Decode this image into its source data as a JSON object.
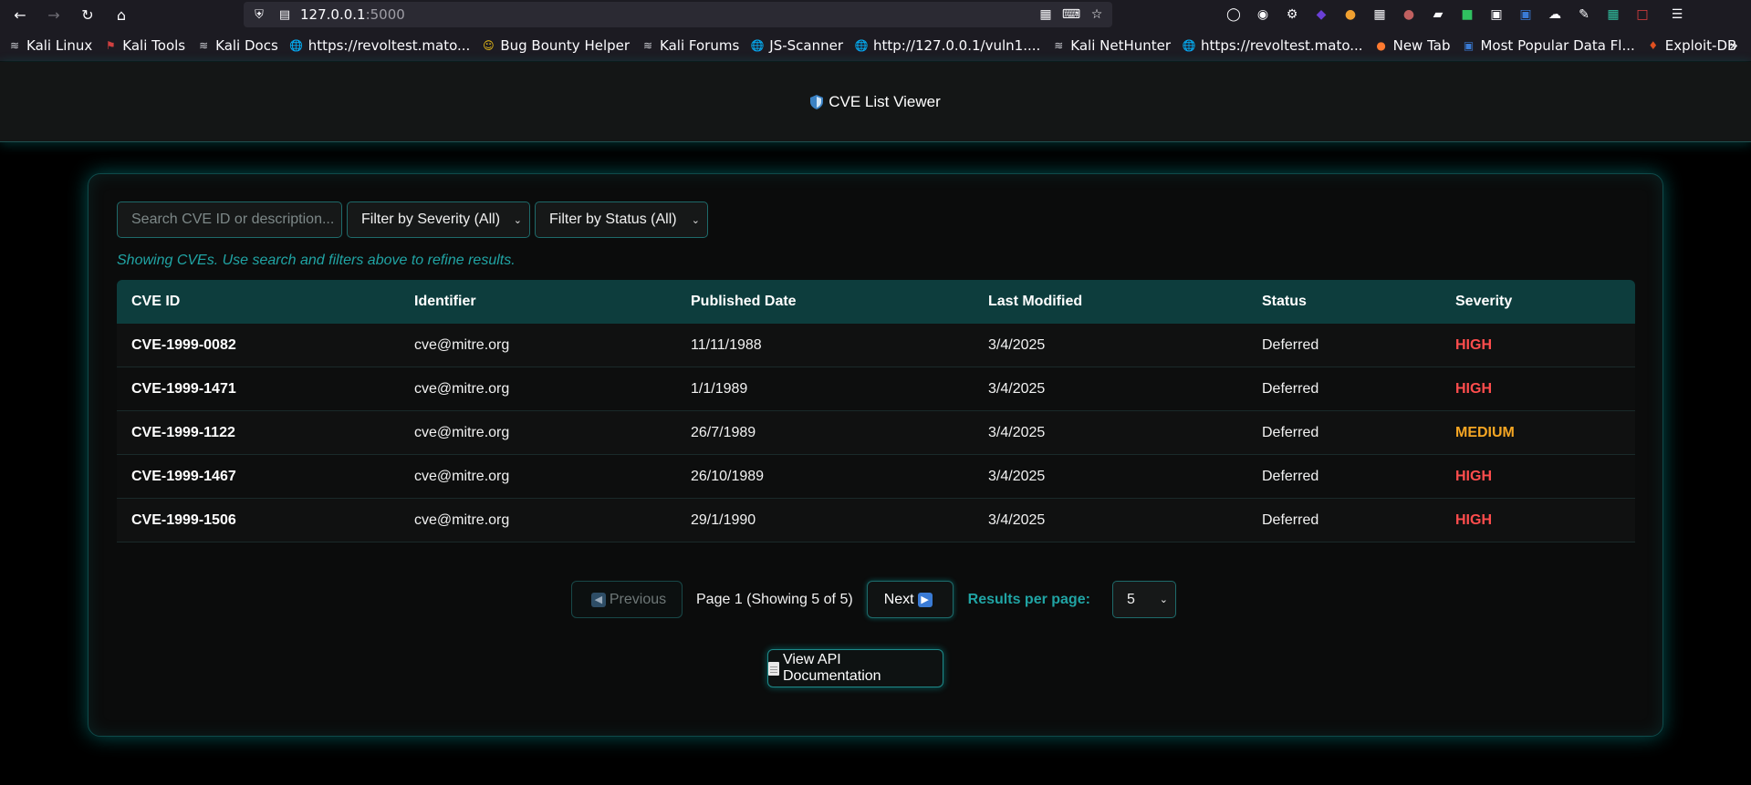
{
  "browser": {
    "url_host": "127.0.0.1",
    "url_port": ":5000",
    "bookmarks": [
      {
        "label": "Kali Linux",
        "icon": "kali-dragon-icon"
      },
      {
        "label": "Kali Tools",
        "icon": "kali-tools-icon"
      },
      {
        "label": "Kali Docs",
        "icon": "kali-dragon-icon"
      },
      {
        "label": "https://revoltest.mato...",
        "icon": "globe-icon"
      },
      {
        "label": "Bug Bounty Helper",
        "icon": "emoji-icon"
      },
      {
        "label": "Kali Forums",
        "icon": "kali-dragon-icon"
      },
      {
        "label": "JS-Scanner",
        "icon": "globe-icon"
      },
      {
        "label": "http://127.0.0.1/vuln1....",
        "icon": "globe-icon"
      },
      {
        "label": "Kali NetHunter",
        "icon": "kali-dragon-icon"
      },
      {
        "label": "https://revoltest.mato...",
        "icon": "globe-icon"
      },
      {
        "label": "New Tab",
        "icon": "firefox-icon"
      },
      {
        "label": "Most Popular Data Fl...",
        "icon": "app-icon"
      },
      {
        "label": "Exploit-DB",
        "icon": "exploit-db-icon"
      }
    ]
  },
  "app": {
    "title": "CVE List Viewer"
  },
  "filters": {
    "search_placeholder": "Search CVE ID or description...",
    "severity_label": "Filter by Severity (All)",
    "status_label": "Filter by Status (All)"
  },
  "hint": "Showing CVEs. Use search and filters above to refine results.",
  "table": {
    "headers": [
      "CVE ID",
      "Identifier",
      "Published Date",
      "Last Modified",
      "Status",
      "Severity"
    ],
    "rows": [
      {
        "id": "CVE-1999-0082",
        "identifier": "cve@mitre.org",
        "published": "11/11/1988",
        "modified": "3/4/2025",
        "status": "Deferred",
        "severity": "HIGH"
      },
      {
        "id": "CVE-1999-1471",
        "identifier": "cve@mitre.org",
        "published": "1/1/1989",
        "modified": "3/4/2025",
        "status": "Deferred",
        "severity": "HIGH"
      },
      {
        "id": "CVE-1999-1122",
        "identifier": "cve@mitre.org",
        "published": "26/7/1989",
        "modified": "3/4/2025",
        "status": "Deferred",
        "severity": "MEDIUM"
      },
      {
        "id": "CVE-1999-1467",
        "identifier": "cve@mitre.org",
        "published": "26/10/1989",
        "modified": "3/4/2025",
        "status": "Deferred",
        "severity": "HIGH"
      },
      {
        "id": "CVE-1999-1506",
        "identifier": "cve@mitre.org",
        "published": "29/1/1990",
        "modified": "3/4/2025",
        "status": "Deferred",
        "severity": "HIGH"
      }
    ]
  },
  "severity_colors": {
    "HIGH": "#ff4d4d",
    "MEDIUM": "#f5a623"
  },
  "pagination": {
    "prev_label": "Previous",
    "page_info": "Page 1 (Showing 5 of 5)",
    "next_label": "Next",
    "rpp_label": "Results per page:",
    "rpp_value": "5"
  },
  "api_button": "View API Documentation",
  "colors": {
    "accent": "#20a4a4",
    "header_bg": "#0d3d3d"
  }
}
